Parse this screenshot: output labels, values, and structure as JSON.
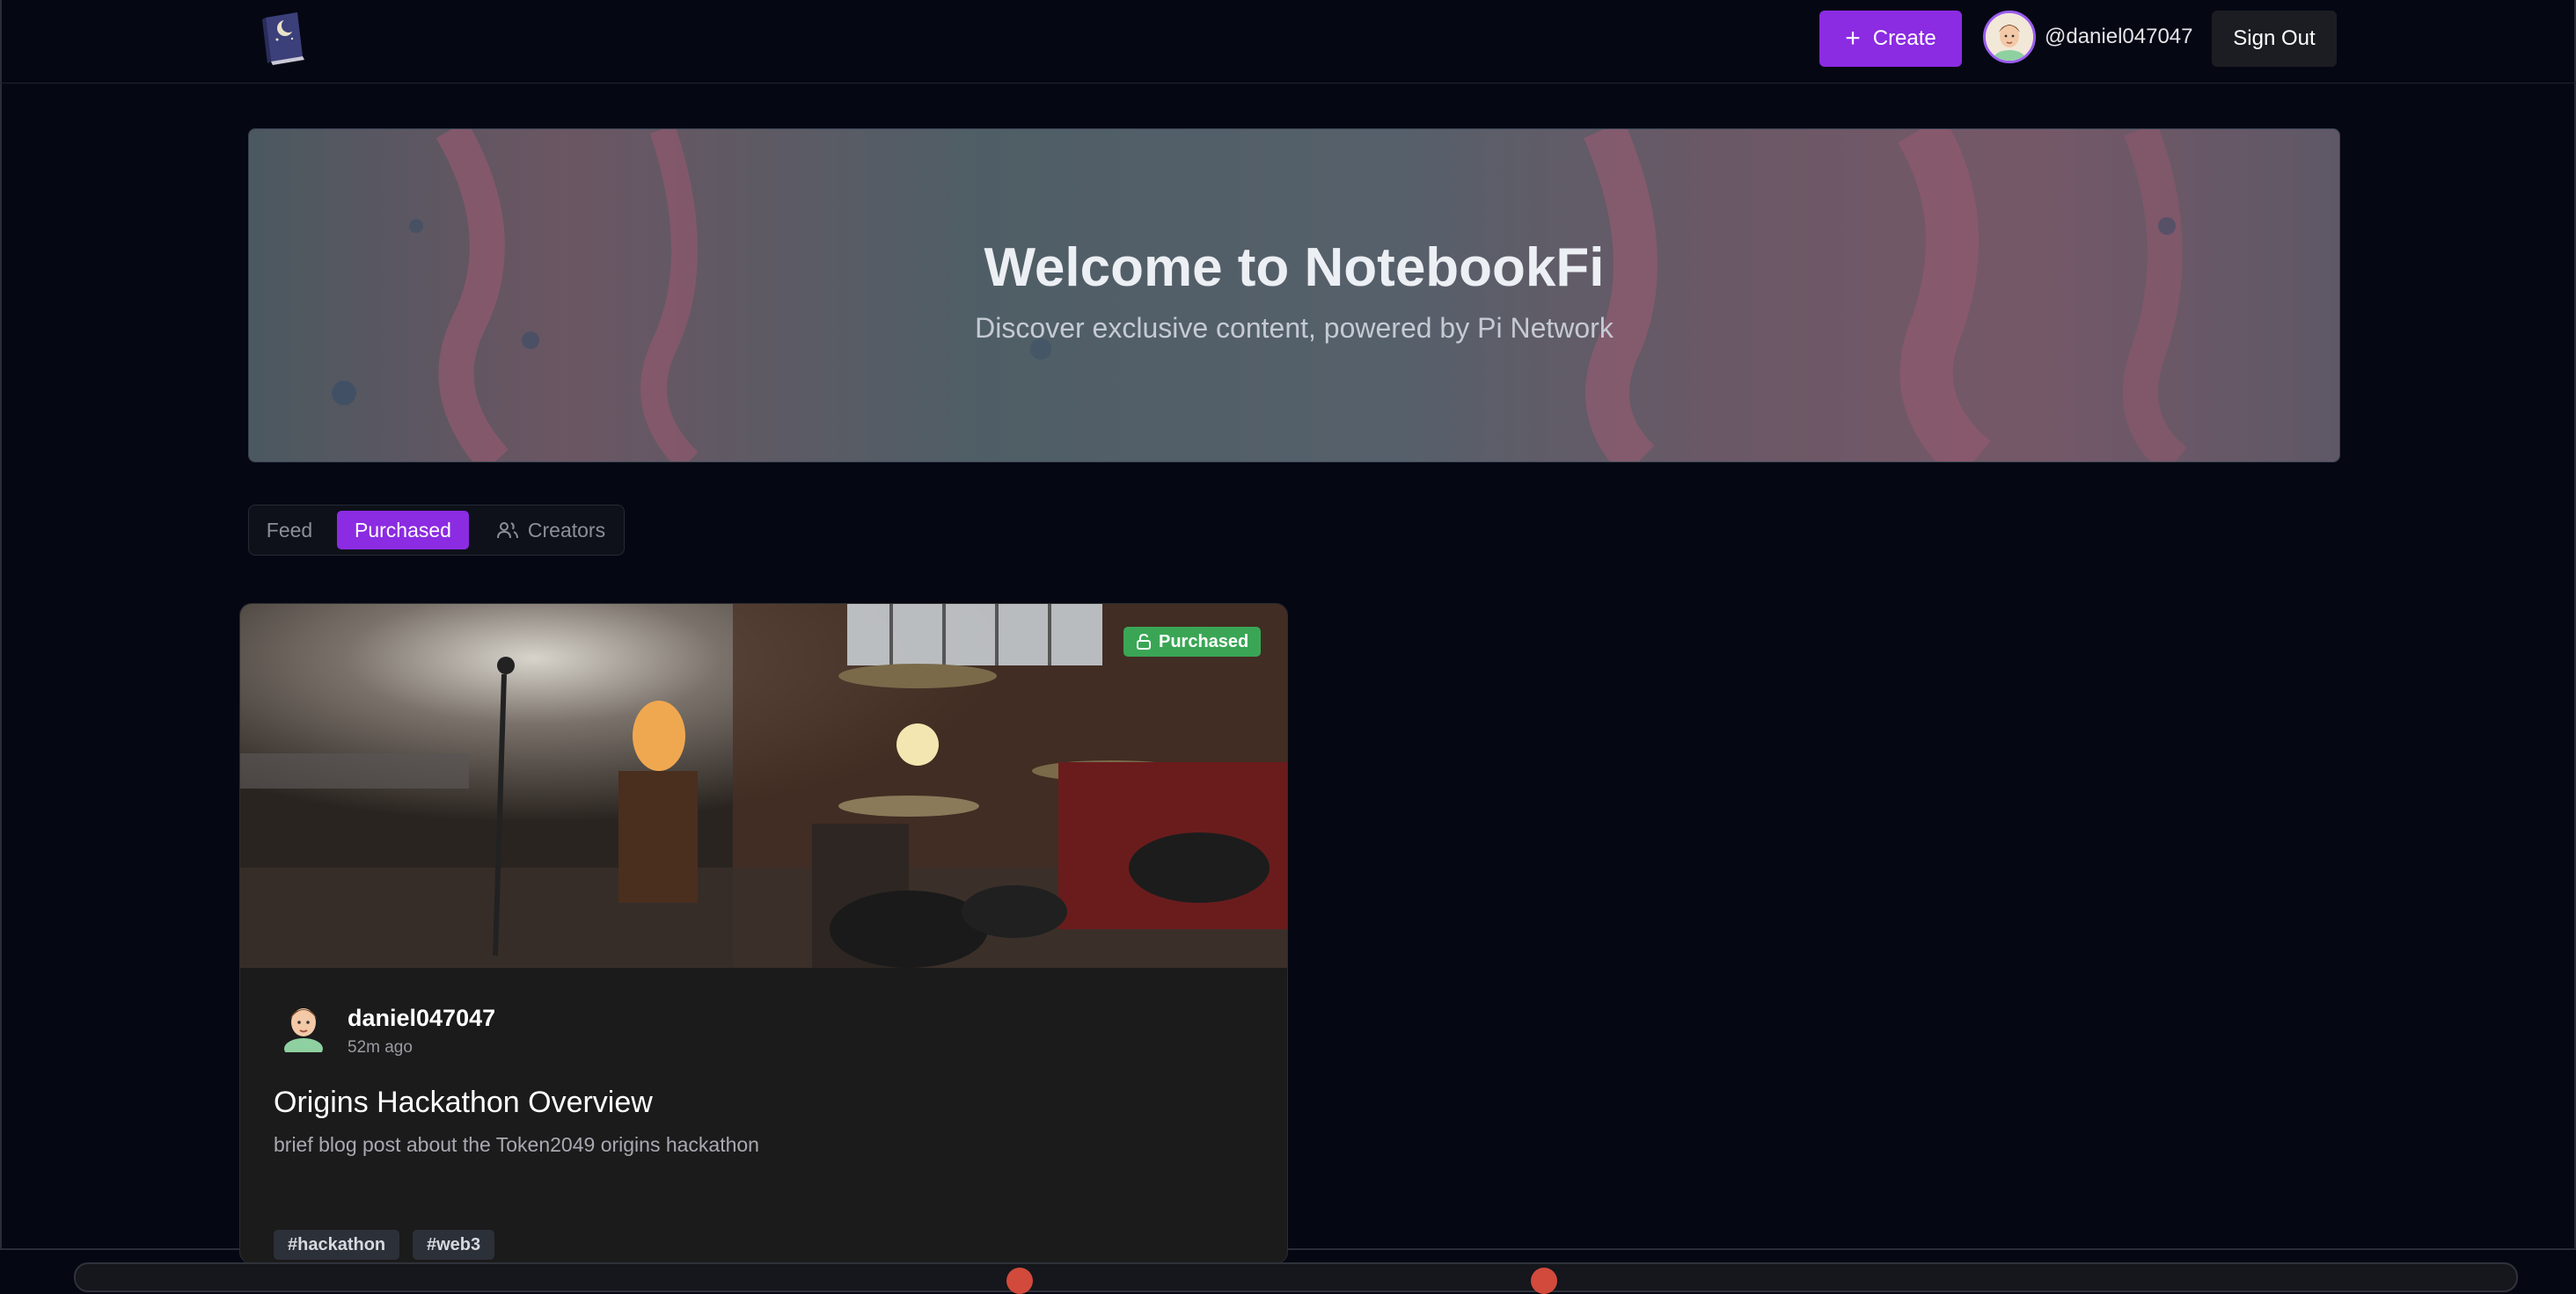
{
  "header": {
    "logo_icon": "notebook-moon-logo",
    "create_label": "Create",
    "username": "@daniel047047",
    "signout_label": "Sign Out"
  },
  "hero": {
    "title": "Welcome to NotebookFi",
    "subtitle": "Discover exclusive content, powered by Pi Network"
  },
  "tabs": [
    {
      "label": "Feed",
      "active": false
    },
    {
      "label": "Purchased",
      "active": true
    },
    {
      "label": "Creators",
      "active": false,
      "icon": "users-icon"
    }
  ],
  "post": {
    "badge": "Purchased",
    "badge_icon": "unlock-icon",
    "author": "daniel047047",
    "time": "52m ago",
    "title": "Origins Hackathon Overview",
    "description": "brief blog post about the Token2049 origins hackathon",
    "tags": [
      "#hackathon",
      "#web3"
    ]
  },
  "colors": {
    "background": "#050813",
    "accent": "#8b2be2",
    "badge": "#3aa655",
    "card": "#1b1b1b"
  }
}
